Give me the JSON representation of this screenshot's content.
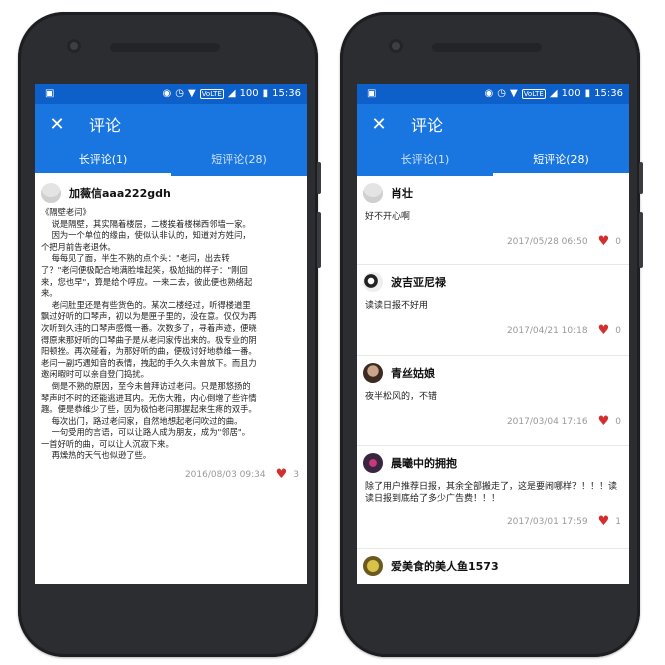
{
  "left": {
    "status": {
      "time": "15:36",
      "battery": "100",
      "net": "VoLTE"
    },
    "appbar": {
      "title": "评论",
      "close_glyph": "✕"
    },
    "tabs": [
      {
        "label": "长评论(1)",
        "active": true
      },
      {
        "label": "短评论(28)",
        "active": false
      }
    ],
    "long_comment": {
      "author": "加薇信aaa222gdh",
      "article": "《隔壁老闫》\n    说是隔壁，其实隔着楼层，二楼挨着楼梯西邻墙一家。\n    因为一个单位的缘由，使似认非认的，知道对方姓闫，\n个把月前告老退休。\n    每每见了面，半生不熟的点个头：\"老闫，出去转\n了？\"老闫便极配合地满脸堆起笑，极尬拙的样子：\"刚回\n来，您也早\"，算是给个呼应。一来二去，彼此便也熟络起\n来。\n    老闫肚里还是有些货色的。某次二楼经过，听得楼道里\n飘过好听的口琴声，初以为是匣子里的，没在意。仅仅为再\n次听到久违的口琴声感慨一番。次数多了，寻着声迹，便晓\n得原来那好听的口琴曲子是从老闫家传出来的。极专业的阴\n阳顿挫。再次碰着，为那好听的曲，便极讨好地恭维一番。\n老闫一副巧遇知音的表情，拽起的手久久未曾放下。而且力\n邀闲暇时可以亲自登门捣扰。\n    倒是不熟的原因，至今未曾拜访过老闫。只是那悠扬的\n琴声时不时的还能逃进耳内。无伤大雅，内心倒增了些许情\n趣。便是恭维少了些，因为极怕老闫那握起来生疼的双手。\n    每次出门，路过老闫家，自然地想起老闫吹过的曲。\n    一句受用的言语，可以让路人成为朋友，成为\"邻居\"。\n一首好听的曲，可以让人沉寂下来。\n    再燥热的天气也似逊了些。",
      "date": "2016/08/03 09:34",
      "likes": "3"
    }
  },
  "right": {
    "status": {
      "time": "15:36",
      "battery": "100",
      "net": "VoLTE"
    },
    "appbar": {
      "title": "评论",
      "close_glyph": "✕"
    },
    "tabs": [
      {
        "label": "长评论(1)",
        "active": false
      },
      {
        "label": "短评论(28)",
        "active": true
      }
    ],
    "short_comments": [
      {
        "author": "肖壮",
        "text": "好不开心啊",
        "date": "2017/05/28 06:50",
        "likes": "0"
      },
      {
        "author": "波吉亚尼禄",
        "text": "读读日报不好用",
        "date": "2017/04/21 10:18",
        "likes": "0"
      },
      {
        "author": "青丝姑娘",
        "text": "夜半松风的，不错",
        "date": "2017/03/04 17:16",
        "likes": "0"
      },
      {
        "author": "晨曦中的拥抱",
        "text": "除了用户推荐日报，其余全部搬走了，这是要闹哪样？！！！读读日报到底给了多少广告费！！！",
        "date": "2017/03/01 17:59",
        "likes": "1"
      },
      {
        "author": "爱美食的美人鱼1573",
        "text": "",
        "date": "",
        "likes": ""
      }
    ]
  },
  "colors": {
    "primary": "#1976e1",
    "status_bar": "#0d5fc9",
    "heart": "#d32f2f"
  },
  "icons": {
    "close": "close-icon",
    "like": "heart-icon",
    "android": "android-icon"
  }
}
